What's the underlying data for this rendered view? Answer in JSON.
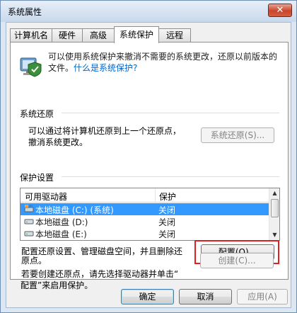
{
  "window": {
    "title": "系统属性",
    "close_glyph": "✕"
  },
  "tabs": [
    {
      "label": "计算机名"
    },
    {
      "label": "硬件"
    },
    {
      "label": "高级"
    },
    {
      "label": "系统保护",
      "active": true
    },
    {
      "label": "远程"
    }
  ],
  "intro": {
    "text": "可以使用系统保护来撤消不需要的系统更改，还原以前版本的文件。",
    "link": "什么是系统保护?"
  },
  "restore": {
    "group": "系统还原",
    "description_1": "可以通过将计算机还原到上一个还原点，",
    "description_2": "撤消系统更改。",
    "button": "系统还原(S)..."
  },
  "protection": {
    "group": "保护设置",
    "columns": {
      "drive": "可用驱动器",
      "protection": "保护"
    },
    "rows": [
      {
        "name": "本地磁盘 (C:) (系统)",
        "protection": "关闭",
        "selected": true,
        "icon": "system-drive-icon"
      },
      {
        "name": "本地磁盘 (D:)",
        "protection": "关闭",
        "selected": false,
        "icon": "drive-icon"
      },
      {
        "name": "本地磁盘 (E:)",
        "protection": "关闭",
        "selected": false,
        "icon": "drive-icon"
      }
    ],
    "config_text_1": "配置还原设置、管理磁盘空间，并且删除还",
    "config_text_2": "原点。",
    "config_button": "配置(O)...",
    "create_text_1": "若要创建还原点，请先选择驱动器并单击“",
    "create_text_2": "配置”来启用保护。",
    "create_button": "创建(C)..."
  },
  "footer": {
    "ok": "确定",
    "cancel": "取消",
    "apply": "应用(A)"
  },
  "colors": {
    "accent": "#3399ff",
    "link": "#0066cc",
    "highlight": "#e02020"
  }
}
